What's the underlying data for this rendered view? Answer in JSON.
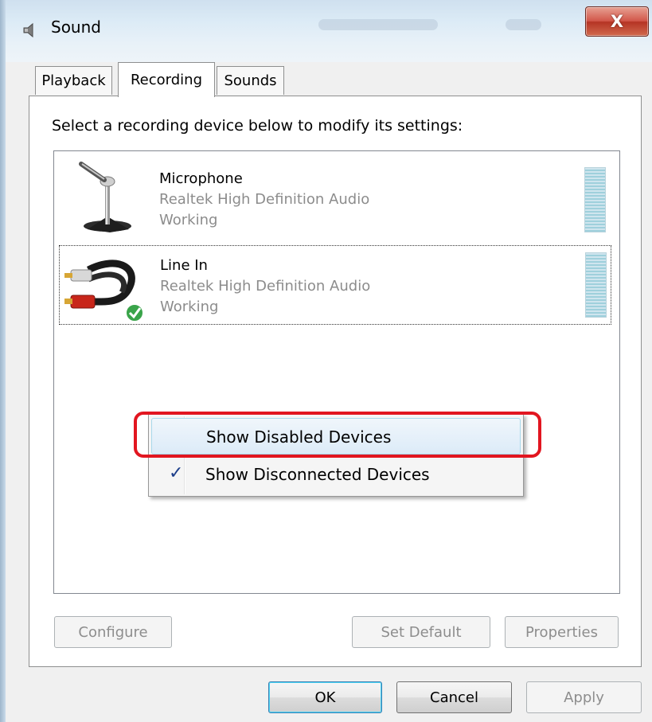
{
  "window": {
    "title": "Sound",
    "close_label": "X"
  },
  "tabs": [
    {
      "label": "Playback"
    },
    {
      "label": "Recording"
    },
    {
      "label": "Sounds"
    }
  ],
  "instruction": "Select a recording device below to modify its settings:",
  "devices": [
    {
      "name": "Microphone",
      "driver": "Realtek High Definition Audio",
      "status": "Working",
      "icon": "microphone-icon"
    },
    {
      "name": "Line In",
      "driver": "Realtek High Definition Audio",
      "status": "Working",
      "icon": "rca-cable-icon",
      "default": true
    }
  ],
  "context_menu": {
    "items": [
      {
        "label": "Show Disabled Devices",
        "checked": false
      },
      {
        "label": "Show Disconnected Devices",
        "checked": true
      }
    ],
    "check_glyph": "✓"
  },
  "panel_buttons": {
    "configure": "Configure",
    "set_default": "Set Default",
    "properties": "Properties"
  },
  "dialog_buttons": {
    "ok": "OK",
    "cancel": "Cancel",
    "apply": "Apply"
  },
  "colors": {
    "highlight_ring": "#e21620",
    "close_button": "#c44a3a"
  }
}
